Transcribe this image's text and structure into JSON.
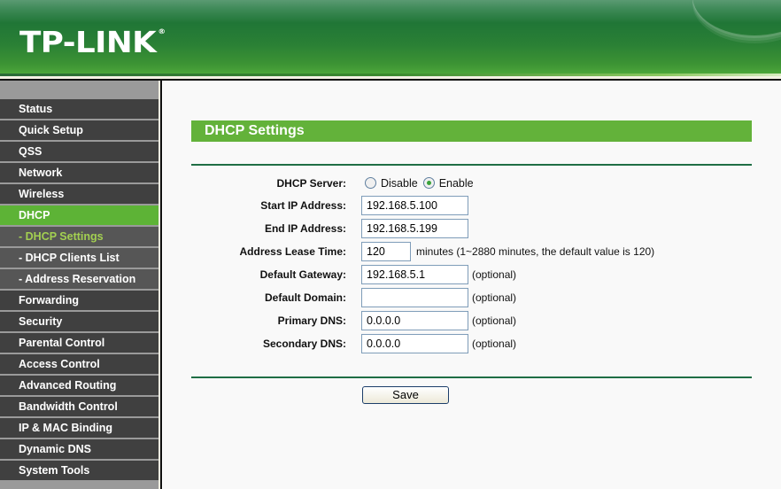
{
  "header": {
    "logo": "TP-LINK",
    "logo_mark": "®"
  },
  "sidebar": {
    "items": [
      {
        "label": "Status",
        "type": "main",
        "state": "normal"
      },
      {
        "label": "Quick Setup",
        "type": "main",
        "state": "normal"
      },
      {
        "label": "QSS",
        "type": "main",
        "state": "normal"
      },
      {
        "label": "Network",
        "type": "main",
        "state": "normal"
      },
      {
        "label": "Wireless",
        "type": "main",
        "state": "normal"
      },
      {
        "label": "DHCP",
        "type": "main",
        "state": "active"
      },
      {
        "label": "- DHCP Settings",
        "type": "sub",
        "state": "current"
      },
      {
        "label": "- DHCP Clients List",
        "type": "sub",
        "state": "normal"
      },
      {
        "label": "- Address Reservation",
        "type": "sub",
        "state": "normal"
      },
      {
        "label": "Forwarding",
        "type": "main",
        "state": "normal"
      },
      {
        "label": "Security",
        "type": "main",
        "state": "normal"
      },
      {
        "label": "Parental Control",
        "type": "main",
        "state": "normal"
      },
      {
        "label": "Access Control",
        "type": "main",
        "state": "normal"
      },
      {
        "label": "Advanced Routing",
        "type": "main",
        "state": "normal"
      },
      {
        "label": "Bandwidth Control",
        "type": "main",
        "state": "normal"
      },
      {
        "label": "IP & MAC Binding",
        "type": "main",
        "state": "normal"
      },
      {
        "label": "Dynamic DNS",
        "type": "main",
        "state": "normal"
      },
      {
        "label": "System Tools",
        "type": "main",
        "state": "normal"
      }
    ]
  },
  "main": {
    "title": "DHCP Settings",
    "dhcp_server": {
      "label": "DHCP Server:",
      "options": [
        "Disable",
        "Enable"
      ],
      "selected": "Enable"
    },
    "start_ip": {
      "label": "Start IP Address:",
      "value": "192.168.5.100"
    },
    "end_ip": {
      "label": "End IP Address:",
      "value": "192.168.5.199"
    },
    "lease_time": {
      "label": "Address Lease Time:",
      "value": "120",
      "hint": "minutes (1~2880 minutes, the default value is 120)"
    },
    "gateway": {
      "label": "Default Gateway:",
      "value": "192.168.5.1",
      "hint": "(optional)"
    },
    "domain": {
      "label": "Default Domain:",
      "value": "",
      "hint": "(optional)"
    },
    "primary_dns": {
      "label": "Primary DNS:",
      "value": "0.0.0.0",
      "hint": "(optional)"
    },
    "secondary_dns": {
      "label": "Secondary DNS:",
      "value": "0.0.0.0",
      "hint": "(optional)"
    },
    "save_label": "Save"
  },
  "colors": {
    "brand_green": "#207636",
    "accent_green": "#63b23a",
    "active_nav": "#5db336",
    "current_sub_text": "#a3d051",
    "nav_bg": "#404040"
  }
}
